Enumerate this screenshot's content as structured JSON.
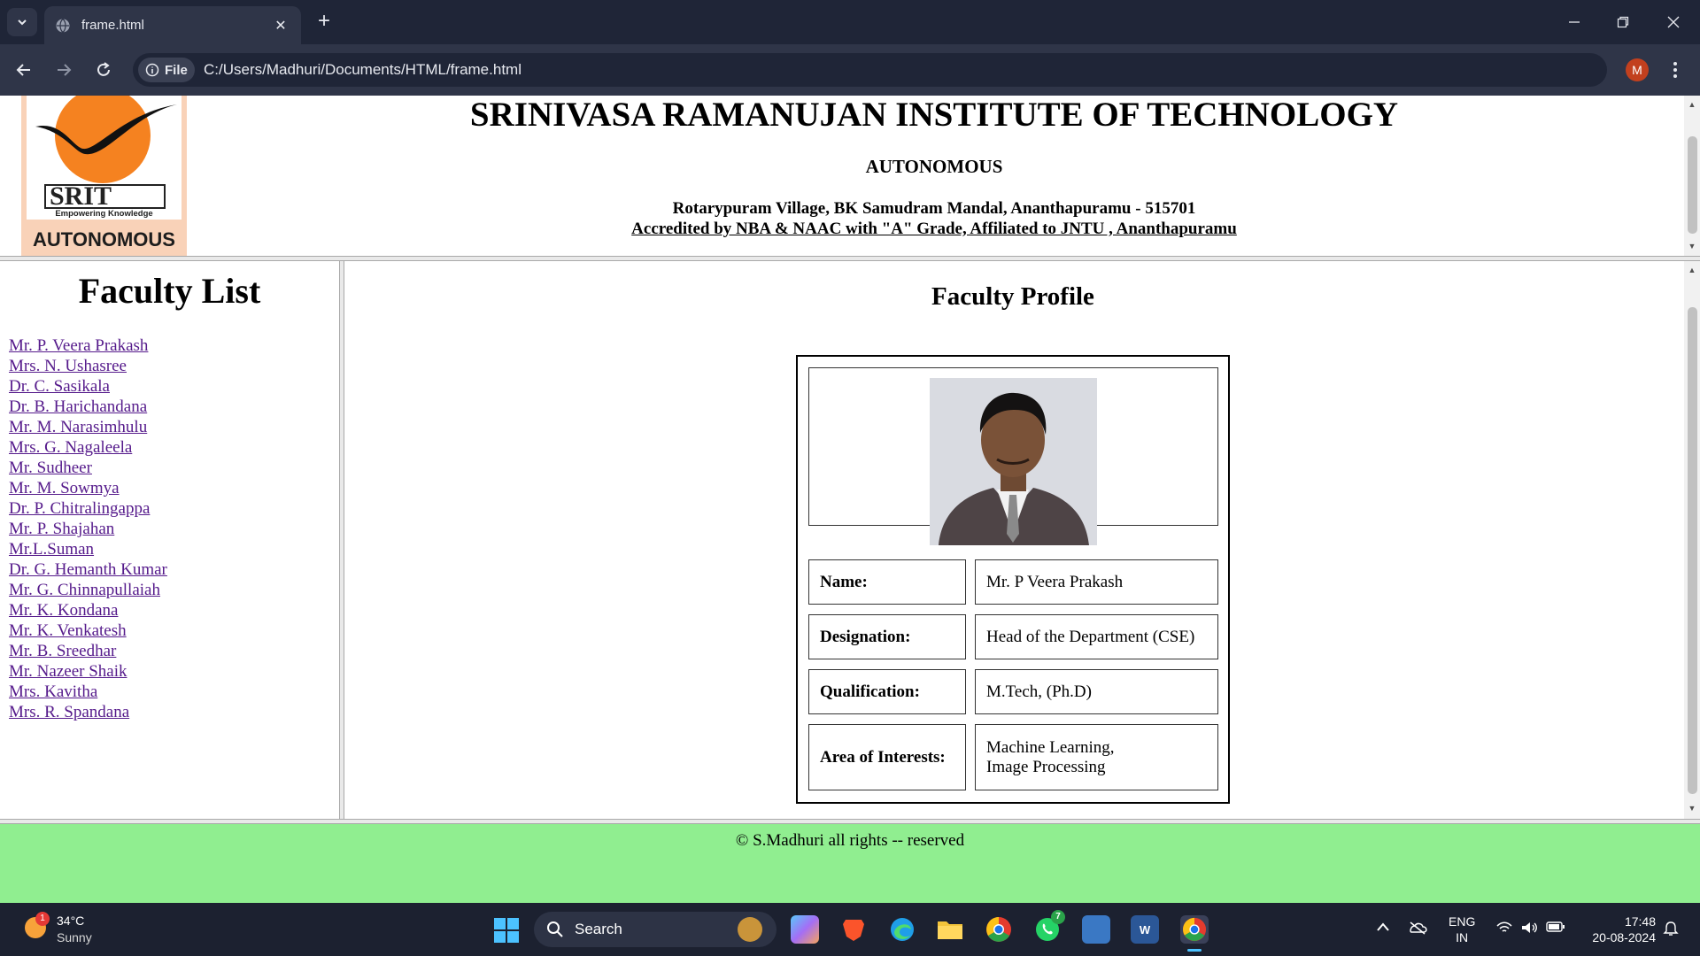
{
  "browser": {
    "tab_title": "frame.html",
    "new_tab_glyph": "+",
    "close_glyph": "✕",
    "site_chip_label": "File",
    "url": "C:/Users/Madhuri/Documents/HTML/frame.html",
    "profile_initial": "M"
  },
  "header": {
    "logo": {
      "mark_text": "SRIT",
      "tagline": "Empowering Knowledge",
      "label": "AUTONOMOUS"
    },
    "institute_name": "SRINIVASA RAMANUJAN INSTITUTE OF TECHNOLOGY",
    "subtitle": "AUTONOMOUS",
    "address": "Rotarypuram Village, BK Samudram Mandal, Ananthapuramu - 515701",
    "accreditation": "Accredited by NBA & NAAC with \"A\" Grade, Affiliated to JNTU , Ananthapuramu"
  },
  "faculty_list": {
    "title": "Faculty List",
    "items": [
      "Mr. P. Veera Prakash",
      "Mrs. N. Ushasree",
      "Dr. C. Sasikala",
      "Dr. B. Harichandana",
      "Mr. M. Narasimhulu",
      "Mrs. G. Nagaleela",
      "Mr. Sudheer",
      "Mr. M. Sowmya",
      "Dr. P. Chitralingappa",
      "Mr. P. Shajahan",
      "Mr.L.Suman",
      "Dr. G. Hemanth Kumar",
      "Mr. G. Chinnapullaiah",
      "Mr. K. Kondana",
      "Mr. K. Venkatesh",
      "Mr. B. Sreedhar",
      "Mr. Nazeer Shaik",
      "Mrs. Kavitha",
      "Mrs. R. Spandana"
    ]
  },
  "profile": {
    "title": "Faculty Profile",
    "rows": [
      {
        "label": "Name:",
        "value": "Mr. P Veera Prakash"
      },
      {
        "label": "Designation:",
        "value": "Head of the Department (CSE)"
      },
      {
        "label": "Qualification:",
        "value": "M.Tech, (Ph.D)"
      },
      {
        "label": "Area of Interests:",
        "value_line1": "Machine Learning,",
        "value_line2": "Image Processing"
      }
    ]
  },
  "footer": {
    "text": "© S.Madhuri all rights -- reserved"
  },
  "taskbar": {
    "weather_temp": "34°C",
    "weather_condition": "Sunny",
    "weather_badge": "1",
    "search_label": "Search",
    "whatsapp_badge": "7",
    "lang_line1": "ENG",
    "lang_line2": "IN",
    "time": "17:48",
    "date": "20-08-2024"
  },
  "colors": {
    "chrome_dark": "#1f2537",
    "chrome_toolbar": "#2f3548",
    "footer_bg": "#90ee90",
    "visited_link": "#551a8b",
    "logo_orange": "#f58220"
  }
}
